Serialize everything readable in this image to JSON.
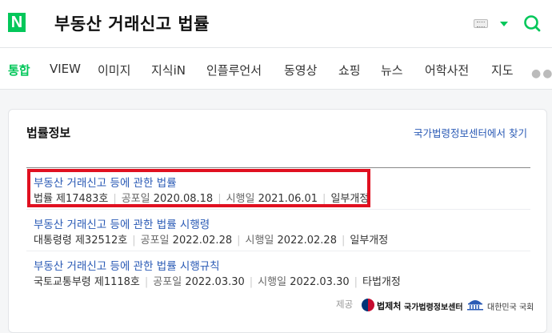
{
  "header": {
    "logo_letter": "N",
    "query": "부동산 거래신고 법률"
  },
  "tabs": [
    {
      "label": "통합",
      "active": true
    },
    {
      "label": "VIEW"
    },
    {
      "label": "이미지"
    },
    {
      "label": "지식iN"
    },
    {
      "label": "인플루언서"
    },
    {
      "label": "동영상"
    },
    {
      "label": "쇼핑"
    },
    {
      "label": "뉴스"
    },
    {
      "label": "어학사전"
    },
    {
      "label": "지도"
    }
  ],
  "card": {
    "title": "법률정보",
    "link": "국가법령정보센터에서 찾기",
    "items": [
      {
        "title": "부동산 거래신고 등에 관한 법률",
        "type": "법률 제17483호",
        "promulgation_label": "공포일",
        "promulgation": "2020.08.18",
        "enforcement_label": "시행일",
        "enforcement": "2021.06.01",
        "revision": "일부개정"
      },
      {
        "title": "부동산 거래신고 등에 관한 법률 시행령",
        "type": "대통령령 제32512호",
        "promulgation_label": "공포일",
        "promulgation": "2022.02.28",
        "enforcement_label": "시행일",
        "enforcement": "2022.02.28",
        "revision": "일부개정"
      },
      {
        "title": "부동산 거래신고 등에 관한 법률 시행규칙",
        "type": "국토교통부령 제1118호",
        "promulgation_label": "공포일",
        "promulgation": "2022.03.30",
        "enforcement_label": "시행일",
        "enforcement": "2022.03.30",
        "revision": "타법개정"
      }
    ],
    "footer": {
      "provider_label": "제공",
      "moleg_name": "법제처",
      "moleg_sub": "국가법령정보센터",
      "assembly_name": "대한민국 국회"
    }
  },
  "colors": {
    "brand_green": "#03c75a",
    "link_blue": "#2a5ab5",
    "highlight_red": "#e01020"
  }
}
